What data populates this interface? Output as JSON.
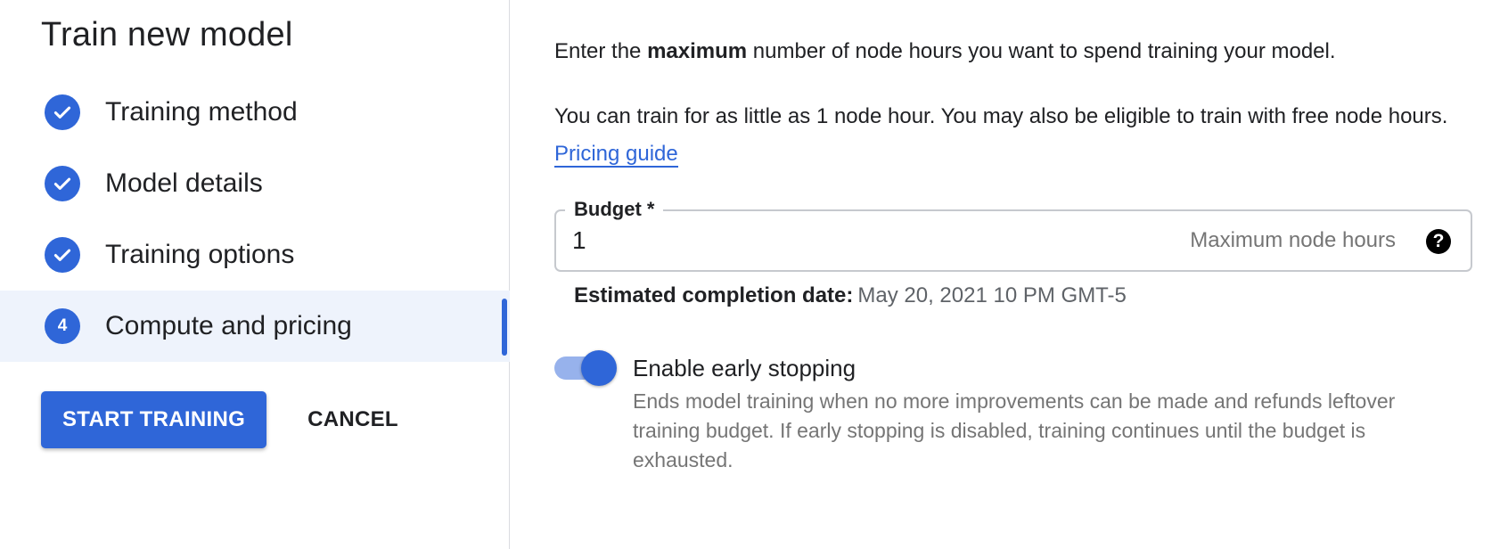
{
  "left_panel": {
    "title": "Train new model",
    "steps": [
      {
        "label": "Training method",
        "status": "completed",
        "icon": "check-icon"
      },
      {
        "label": "Model details",
        "status": "completed",
        "icon": "check-icon"
      },
      {
        "label": "Training options",
        "status": "completed",
        "icon": "check-icon"
      },
      {
        "label": "Compute and pricing",
        "status": "active",
        "number": "4"
      }
    ],
    "actions": {
      "primary_label": "START TRAINING",
      "cancel_label": "CANCEL"
    }
  },
  "right_panel": {
    "intro": {
      "before": "Enter the ",
      "bold": "maximum",
      "after": " number of node hours you want to spend training your model."
    },
    "info": {
      "text": "You can train for as little as 1 node hour. You may also be eligible to train with free node hours. ",
      "link": "Pricing guide"
    },
    "budget_field": {
      "label": "Budget *",
      "value": "1",
      "suffix": "Maximum node hours",
      "help_icon": "help-circle-icon",
      "help_glyph": "?"
    },
    "estimate": {
      "label": "Estimated completion date:",
      "value": "May 20, 2021 10 PM GMT-5"
    },
    "early_stopping": {
      "enabled": true,
      "title": "Enable early stopping",
      "description": "Ends model training when no more improvements can be made and refunds leftover training budget. If early stopping is disabled, training continues until the budget is exhausted."
    }
  },
  "colors": {
    "accent": "#2f66d8",
    "active_step_bg": "#eef3fc",
    "toggle_track": "#97b2ec",
    "secondary_text": "#757575"
  }
}
